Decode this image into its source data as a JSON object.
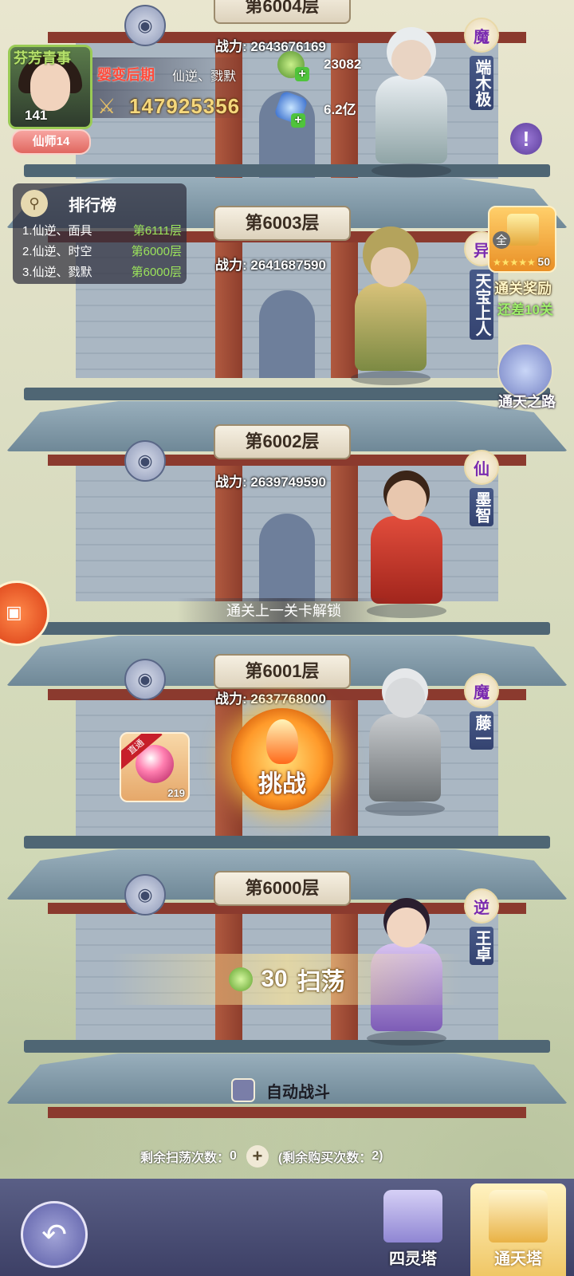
{
  "player": {
    "logo_text": "芬芳青事",
    "level": "141",
    "title_badge": "仙师14",
    "realm": "婴变后期",
    "name": "仙逆、戮默",
    "combat_power": "147925356"
  },
  "resources": {
    "jade": "23082",
    "crystal": "6.2亿"
  },
  "ranking": {
    "title": "排行榜",
    "entries": [
      {
        "name": "1.仙逆、面具",
        "floor": "第6111层"
      },
      {
        "name": "2.仙逆、时空",
        "floor": "第6000层"
      },
      {
        "name": "3.仙逆、戮默",
        "floor": "第6000层"
      }
    ]
  },
  "floors": [
    {
      "label": "第6004层",
      "power": "战力: 2643676169",
      "faction": "魔",
      "boss": "端木极"
    },
    {
      "label": "第6003层",
      "power": "战力: 2641687590",
      "faction": "异",
      "boss": "天宝上人"
    },
    {
      "label": "第6002层",
      "power": "战力: 2639749590",
      "faction": "仙",
      "boss": "墨智"
    },
    {
      "label": "第6001层",
      "power": "战力: 2637768000",
      "faction": "魔",
      "boss": "藤一"
    },
    {
      "label": "第6000层",
      "power": "",
      "faction": "逆",
      "boss": "王卓"
    }
  ],
  "reward": {
    "quan": "全",
    "stars": "★★★★★",
    "count": "50",
    "label": "通关奖励",
    "remaining": "还差10关"
  },
  "road": {
    "label": "通天之路"
  },
  "unlock_hint": "通关上一关卡解锁",
  "challenge_label": "挑战",
  "gift": {
    "ribbon": "直通",
    "count": "219"
  },
  "sweep": {
    "cost": "30",
    "label": "扫荡"
  },
  "auto_battle": {
    "label": "自动战斗",
    "checked": false
  },
  "sweep_remaining": {
    "label": "剩余扫荡次数：",
    "value": "0",
    "buy_label": "(剩余购买次数：",
    "buy_value": "2",
    "buy_close": ")"
  },
  "tabs": [
    {
      "label": "四灵塔",
      "selected": false
    },
    {
      "label": "通天塔",
      "selected": true
    }
  ],
  "colors": {
    "accent_gold": "#f4d77c",
    "realm_red": "#ff4a3a",
    "rank_green": "#9be35b",
    "bottom_bar": "#4b4f78"
  }
}
